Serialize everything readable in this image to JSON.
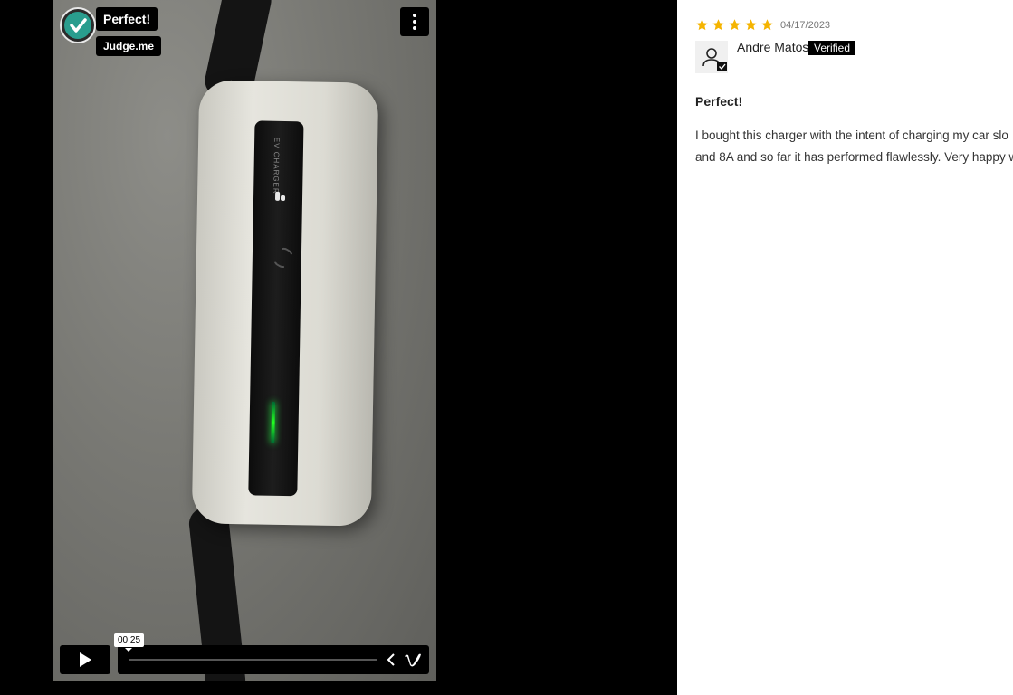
{
  "video": {
    "title": "Perfect!",
    "source": "Judge.me",
    "charger_label": "EV CHARGER",
    "time_display": "00:25",
    "progress": 0.0
  },
  "icons": {
    "menu": "more-vertical-icon",
    "play": "play-icon",
    "share": "share-icon",
    "vimeo": "vimeo-icon",
    "logo": "judge-me-logo-icon",
    "avatar": "user-verified-icon",
    "star": "star-icon"
  },
  "colors": {
    "star": "#f5b400",
    "logo_teal": "#299d8e",
    "badge_bg": "#000000"
  },
  "review": {
    "rating": 5,
    "date": "04/17/2023",
    "reviewer": "Andre Matos",
    "verified_label": "Verified",
    "title": "Perfect!",
    "body_line1": "I bought this charger with the intent of charging my car slo",
    "body_line2": "and 8A and so far it has performed flawlessly. Very happy w"
  }
}
